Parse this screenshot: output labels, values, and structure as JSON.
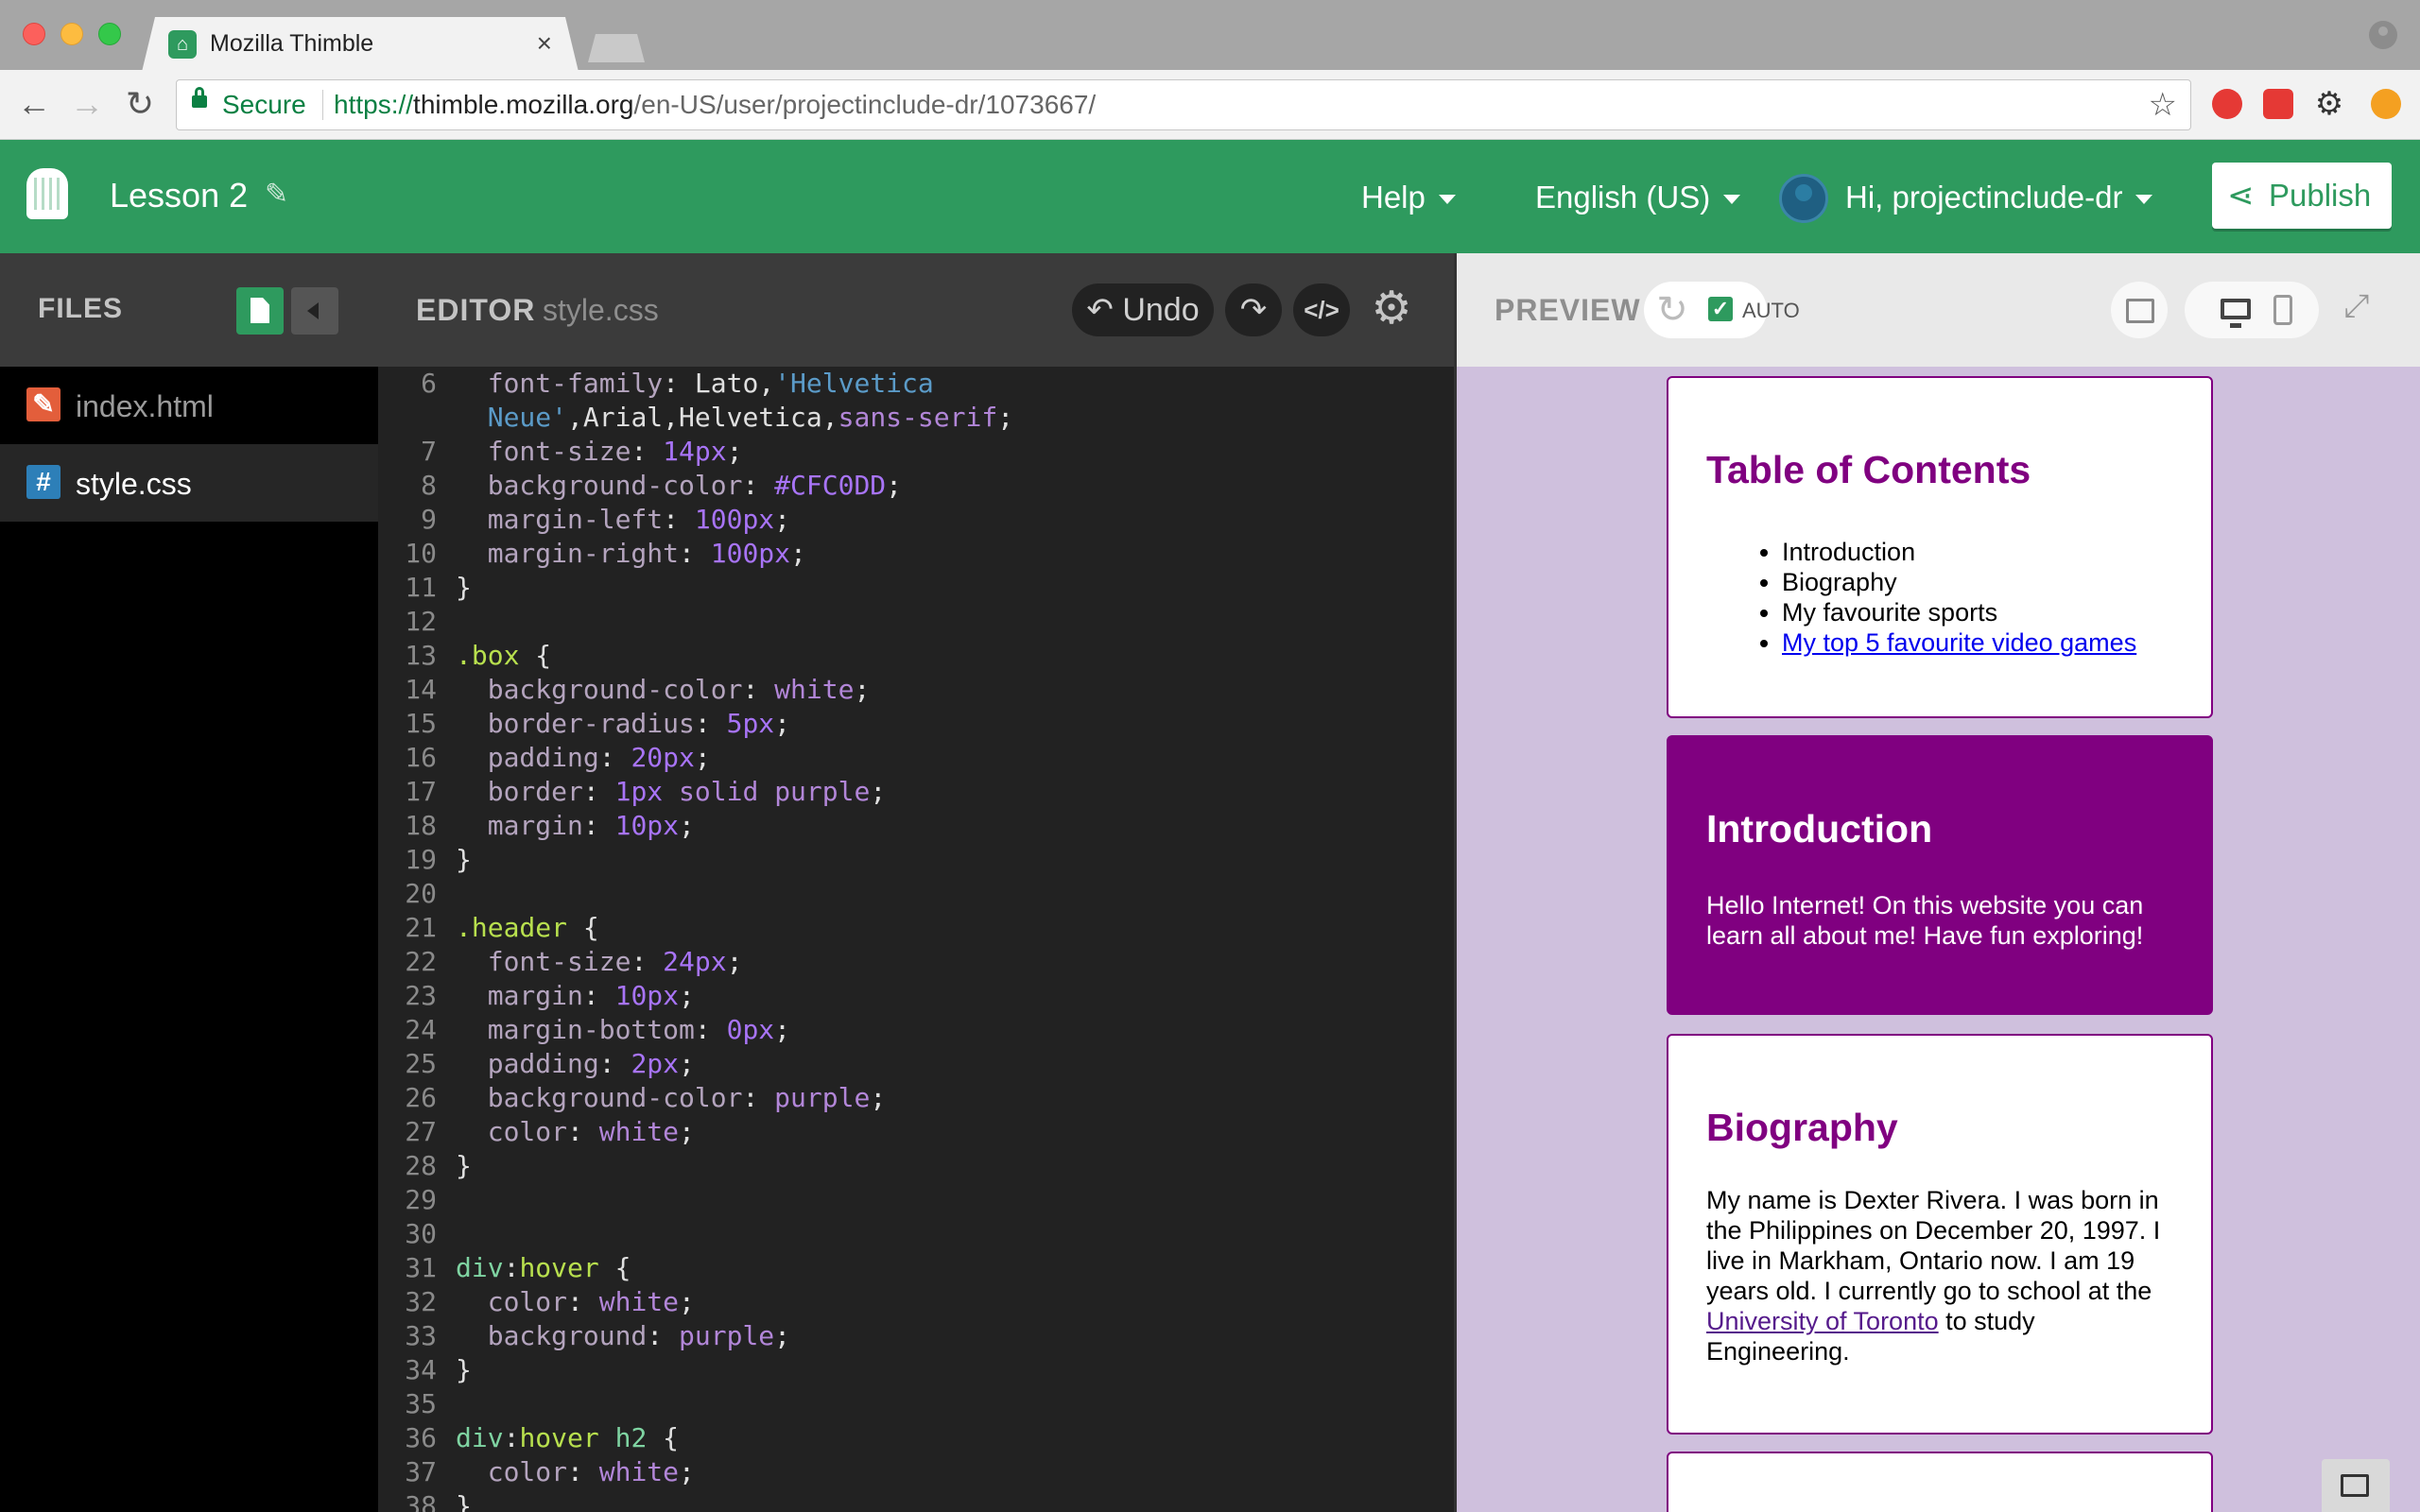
{
  "browser": {
    "tab_title": "Mozilla Thimble",
    "tab_close": "×",
    "secure_label": "Secure",
    "url_scheme": "https://",
    "url_host": "thimble.mozilla.org",
    "url_path": "/en-US/user/projectinclude-dr/1073667/"
  },
  "header": {
    "project_title": "Lesson 2",
    "help": "Help",
    "language": "English (US)",
    "user": "Hi, projectinclude-dr",
    "publish": "Publish"
  },
  "files": {
    "title": "FILES",
    "items": [
      {
        "name": "index.html",
        "icon": "pencil-icon",
        "glyph": "✎",
        "selected": false
      },
      {
        "name": "style.css",
        "icon": "hash-icon",
        "glyph": "#",
        "selected": true
      }
    ]
  },
  "editor": {
    "title": "EDITOR",
    "filename": "style.css",
    "undo": "Undo",
    "lines": [
      {
        "n": "6",
        "tokens": [
          [
            "  ",
            "t-plain"
          ],
          [
            "font-family",
            "t-prop"
          ],
          [
            ": ",
            "t-plain"
          ],
          [
            "Lato",
            "t-plain"
          ],
          [
            ",",
            "t-plain"
          ],
          [
            "'Helvetica",
            "t-str"
          ]
        ]
      },
      {
        "n": "",
        "tokens": [
          [
            "  ",
            "t-plain"
          ],
          [
            "Neue'",
            "t-str"
          ],
          [
            ",",
            "t-plain"
          ],
          [
            "Arial",
            "t-plain"
          ],
          [
            ",",
            "t-plain"
          ],
          [
            "Helvetica",
            "t-plain"
          ],
          [
            ",",
            "t-plain"
          ],
          [
            "sans-serif",
            "t-kw"
          ],
          [
            ";",
            "t-plain"
          ]
        ]
      },
      {
        "n": "7",
        "tokens": [
          [
            "  ",
            "t-plain"
          ],
          [
            "font-size",
            "t-prop"
          ],
          [
            ": ",
            "t-plain"
          ],
          [
            "14px",
            "t-num"
          ],
          [
            ";",
            "t-plain"
          ]
        ]
      },
      {
        "n": "8",
        "tokens": [
          [
            "  ",
            "t-plain"
          ],
          [
            "background-color",
            "t-prop"
          ],
          [
            ": ",
            "t-plain"
          ],
          [
            "#CFC0DD",
            "t-num"
          ],
          [
            ";",
            "t-plain"
          ]
        ]
      },
      {
        "n": "9",
        "tokens": [
          [
            "  ",
            "t-plain"
          ],
          [
            "margin-left",
            "t-prop"
          ],
          [
            ": ",
            "t-plain"
          ],
          [
            "100px",
            "t-num"
          ],
          [
            ";",
            "t-plain"
          ]
        ]
      },
      {
        "n": "10",
        "tokens": [
          [
            "  ",
            "t-plain"
          ],
          [
            "margin-right",
            "t-prop"
          ],
          [
            ": ",
            "t-plain"
          ],
          [
            "100px",
            "t-num"
          ],
          [
            ";",
            "t-plain"
          ]
        ]
      },
      {
        "n": "11",
        "tokens": [
          [
            "}",
            "t-plain"
          ]
        ]
      },
      {
        "n": "12",
        "tokens": []
      },
      {
        "n": "13",
        "tokens": [
          [
            ".box",
            "t-sel"
          ],
          [
            " {",
            "t-plain"
          ]
        ]
      },
      {
        "n": "14",
        "tokens": [
          [
            "  ",
            "t-plain"
          ],
          [
            "background-color",
            "t-prop"
          ],
          [
            ": ",
            "t-plain"
          ],
          [
            "white",
            "t-kw"
          ],
          [
            ";",
            "t-plain"
          ]
        ]
      },
      {
        "n": "15",
        "tokens": [
          [
            "  ",
            "t-plain"
          ],
          [
            "border-radius",
            "t-prop"
          ],
          [
            ": ",
            "t-plain"
          ],
          [
            "5px",
            "t-num"
          ],
          [
            ";",
            "t-plain"
          ]
        ]
      },
      {
        "n": "16",
        "tokens": [
          [
            "  ",
            "t-plain"
          ],
          [
            "padding",
            "t-prop"
          ],
          [
            ": ",
            "t-plain"
          ],
          [
            "20px",
            "t-num"
          ],
          [
            ";",
            "t-plain"
          ]
        ]
      },
      {
        "n": "17",
        "tokens": [
          [
            "  ",
            "t-plain"
          ],
          [
            "border",
            "t-prop"
          ],
          [
            ": ",
            "t-plain"
          ],
          [
            "1px",
            "t-num"
          ],
          [
            " ",
            "t-plain"
          ],
          [
            "solid",
            "t-kw"
          ],
          [
            " ",
            "t-plain"
          ],
          [
            "purple",
            "t-kw"
          ],
          [
            ";",
            "t-plain"
          ]
        ]
      },
      {
        "n": "18",
        "tokens": [
          [
            "  ",
            "t-plain"
          ],
          [
            "margin",
            "t-prop"
          ],
          [
            ": ",
            "t-plain"
          ],
          [
            "10px",
            "t-num"
          ],
          [
            ";",
            "t-plain"
          ]
        ]
      },
      {
        "n": "19",
        "tokens": [
          [
            "}",
            "t-plain"
          ]
        ]
      },
      {
        "n": "20",
        "tokens": []
      },
      {
        "n": "21",
        "tokens": [
          [
            ".header",
            "t-sel"
          ],
          [
            " {",
            "t-plain"
          ]
        ]
      },
      {
        "n": "22",
        "tokens": [
          [
            "  ",
            "t-plain"
          ],
          [
            "font-size",
            "t-prop"
          ],
          [
            ": ",
            "t-plain"
          ],
          [
            "24px",
            "t-num"
          ],
          [
            ";",
            "t-plain"
          ]
        ]
      },
      {
        "n": "23",
        "tokens": [
          [
            "  ",
            "t-plain"
          ],
          [
            "margin",
            "t-prop"
          ],
          [
            ": ",
            "t-plain"
          ],
          [
            "10px",
            "t-num"
          ],
          [
            ";",
            "t-plain"
          ]
        ]
      },
      {
        "n": "24",
        "tokens": [
          [
            "  ",
            "t-plain"
          ],
          [
            "margin-bottom",
            "t-prop"
          ],
          [
            ": ",
            "t-plain"
          ],
          [
            "0px",
            "t-num"
          ],
          [
            ";",
            "t-plain"
          ]
        ]
      },
      {
        "n": "25",
        "tokens": [
          [
            "  ",
            "t-plain"
          ],
          [
            "padding",
            "t-prop"
          ],
          [
            ": ",
            "t-plain"
          ],
          [
            "2px",
            "t-num"
          ],
          [
            ";",
            "t-plain"
          ]
        ]
      },
      {
        "n": "26",
        "tokens": [
          [
            "  ",
            "t-plain"
          ],
          [
            "background-color",
            "t-prop"
          ],
          [
            ": ",
            "t-plain"
          ],
          [
            "purple",
            "t-kw"
          ],
          [
            ";",
            "t-plain"
          ]
        ]
      },
      {
        "n": "27",
        "tokens": [
          [
            "  ",
            "t-plain"
          ],
          [
            "color",
            "t-prop"
          ],
          [
            ": ",
            "t-plain"
          ],
          [
            "white",
            "t-kw"
          ],
          [
            ";",
            "t-plain"
          ]
        ]
      },
      {
        "n": "28",
        "tokens": [
          [
            "}",
            "t-plain"
          ]
        ]
      },
      {
        "n": "29",
        "tokens": []
      },
      {
        "n": "30",
        "tokens": []
      },
      {
        "n": "31",
        "tokens": [
          [
            "div",
            "t-tag"
          ],
          [
            ":",
            "t-plain"
          ],
          [
            "hover",
            "t-sel"
          ],
          [
            " {",
            "t-plain"
          ]
        ]
      },
      {
        "n": "32",
        "tokens": [
          [
            "  ",
            "t-plain"
          ],
          [
            "color",
            "t-prop"
          ],
          [
            ": ",
            "t-plain"
          ],
          [
            "white",
            "t-kw"
          ],
          [
            ";",
            "t-plain"
          ]
        ]
      },
      {
        "n": "33",
        "tokens": [
          [
            "  ",
            "t-plain"
          ],
          [
            "background",
            "t-prop"
          ],
          [
            ": ",
            "t-plain"
          ],
          [
            "purple",
            "t-kw"
          ],
          [
            ";",
            "t-plain"
          ]
        ]
      },
      {
        "n": "34",
        "tokens": [
          [
            "}",
            "t-plain"
          ]
        ]
      },
      {
        "n": "35",
        "tokens": []
      },
      {
        "n": "36",
        "tokens": [
          [
            "div",
            "t-tag"
          ],
          [
            ":",
            "t-plain"
          ],
          [
            "hover",
            "t-sel"
          ],
          [
            " ",
            "t-plain"
          ],
          [
            "h2",
            "t-tag"
          ],
          [
            " {",
            "t-plain"
          ]
        ]
      },
      {
        "n": "37",
        "tokens": [
          [
            "  ",
            "t-plain"
          ],
          [
            "color",
            "t-prop"
          ],
          [
            ": ",
            "t-plain"
          ],
          [
            "white",
            "t-kw"
          ],
          [
            ";",
            "t-plain"
          ]
        ]
      },
      {
        "n": "38",
        "tokens": [
          [
            "}",
            "t-plain"
          ]
        ]
      }
    ]
  },
  "preview": {
    "title": "PREVIEW",
    "auto_label": "AUTO",
    "toc_heading": "Table of Contents",
    "toc_items": [
      {
        "text": "Introduction",
        "link": false
      },
      {
        "text": "Biography",
        "link": false
      },
      {
        "text": "My favourite sports",
        "link": false
      },
      {
        "text": "My top 5 favourite video games",
        "link": true
      }
    ],
    "intro_heading": "Introduction",
    "intro_text": "Hello Internet! On this website you can learn all about me! Have fun exploring!",
    "bio_heading": "Biography",
    "bio_text_before": "My name is Dexter Rivera. I was born in the Philippines on December 20, 1997. I live in Markham, Ontario now. I am 19 years old. I currently go to school at the ",
    "bio_link": "University of Toronto",
    "bio_text_after": " to study Engineering."
  },
  "colors": {
    "thimble_green": "#2e9a5e",
    "preview_bg": "#CFC0DD",
    "purple": "#800080"
  }
}
